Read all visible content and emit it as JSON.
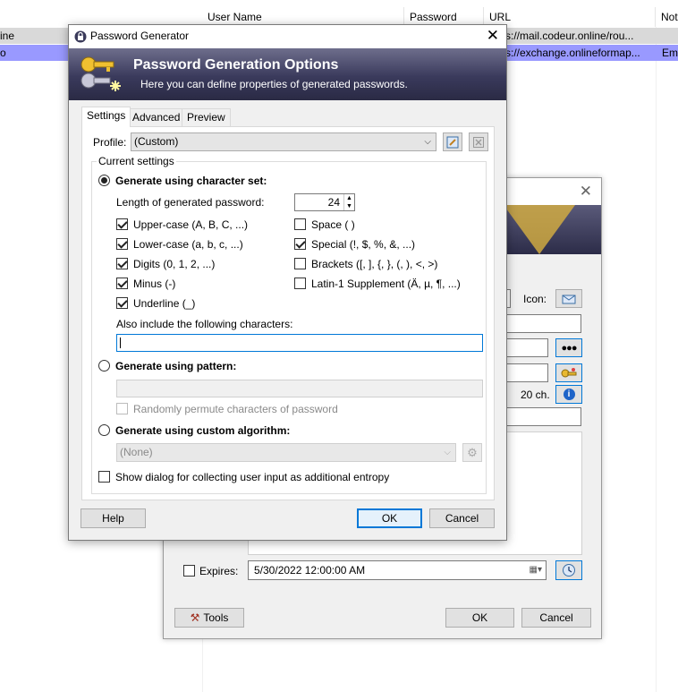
{
  "list": {
    "columns": [
      "User Name",
      "Password",
      "URL",
      "Not"
    ],
    "rows": [
      {
        "title": "ine",
        "url": "s://mail.codeur.online/rou...",
        "notes": ""
      },
      {
        "title": "o",
        "url": "s://exchange.onlineformap...",
        "notes": "Em"
      }
    ]
  },
  "back_dialog": {
    "icon_label": "Icon:",
    "length_label": "20 ch.",
    "expires_label": "Expires:",
    "expires_value": "5/30/2022 12:00:00 AM",
    "tools_label": "Tools",
    "ok_label": "OK",
    "cancel_label": "Cancel",
    "expires_checked": false
  },
  "dialog": {
    "title": "Password Generator",
    "banner_title": "Password Generation Options",
    "banner_subtitle": "Here you can define properties of generated passwords.",
    "tabs": [
      "Settings",
      "Advanced",
      "Preview"
    ],
    "active_tab": "Settings",
    "profile_label": "Profile:",
    "profile_value": "(Custom)",
    "group_title": "Current settings",
    "charset_radio": "Generate using character set:",
    "length_label": "Length of generated password:",
    "length_value": "24",
    "options_left": [
      {
        "label": "Upper-case (A, B, C, ...)",
        "checked": true
      },
      {
        "label": "Lower-case (a, b, c, ...)",
        "checked": true
      },
      {
        "label": "Digits (0, 1, 2, ...)",
        "checked": true
      },
      {
        "label": "Minus (-)",
        "checked": true
      },
      {
        "label": "Underline (_)",
        "checked": true
      }
    ],
    "options_right": [
      {
        "label": "Space ( )",
        "checked": false
      },
      {
        "label": "Special (!, $, %, &, ...)",
        "checked": true
      },
      {
        "label": "Brackets ([, ], {, }, (, ), <, >)",
        "checked": false
      },
      {
        "label": "Latin-1 Supplement (Ä, µ, ¶, ...)",
        "checked": false
      }
    ],
    "also_include_label": "Also include the following characters:",
    "also_include_value": "",
    "pattern_radio": "Generate using pattern:",
    "pattern_value": "",
    "permute_label": "Randomly permute characters of password",
    "custom_radio": "Generate using custom algorithm:",
    "custom_value": "(None)",
    "entropy_label": "Show dialog for collecting user input as additional entropy",
    "help_label": "Help",
    "ok_label": "OK",
    "cancel_label": "Cancel"
  }
}
